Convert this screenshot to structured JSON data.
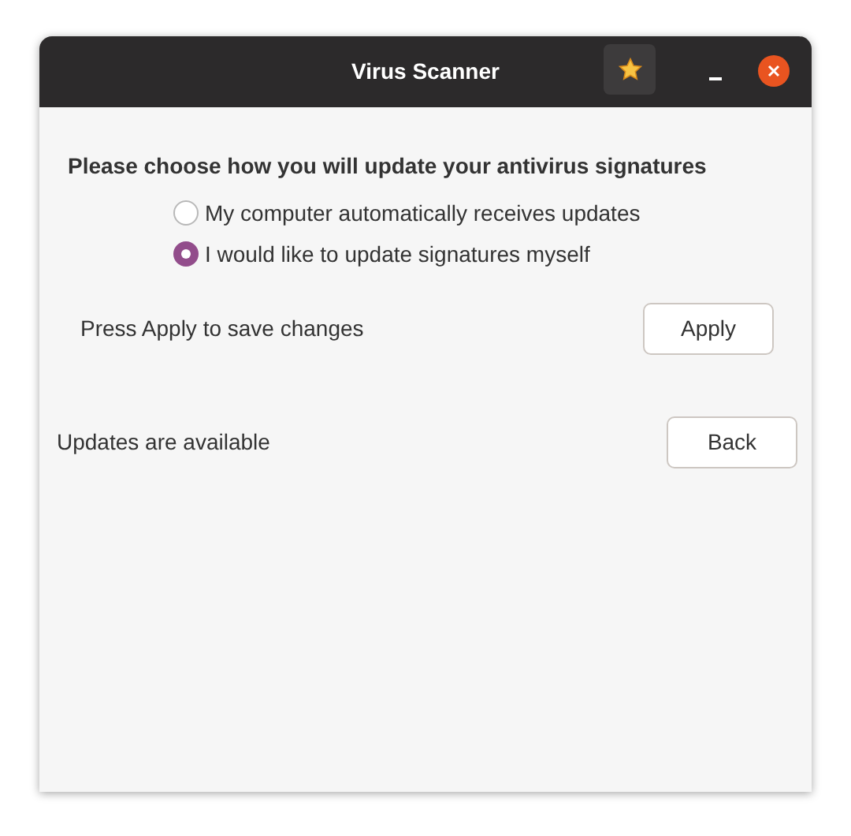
{
  "window": {
    "title": "Virus Scanner"
  },
  "heading": "Please choose how you will update your antivirus signatures",
  "options": [
    {
      "label": "My computer automatically receives updates",
      "selected": false
    },
    {
      "label": "I would like to update signatures myself",
      "selected": true
    }
  ],
  "apply_row": {
    "text": "Press Apply to save changes",
    "button": "Apply"
  },
  "status_row": {
    "text": "Updates are available",
    "button": "Back"
  }
}
